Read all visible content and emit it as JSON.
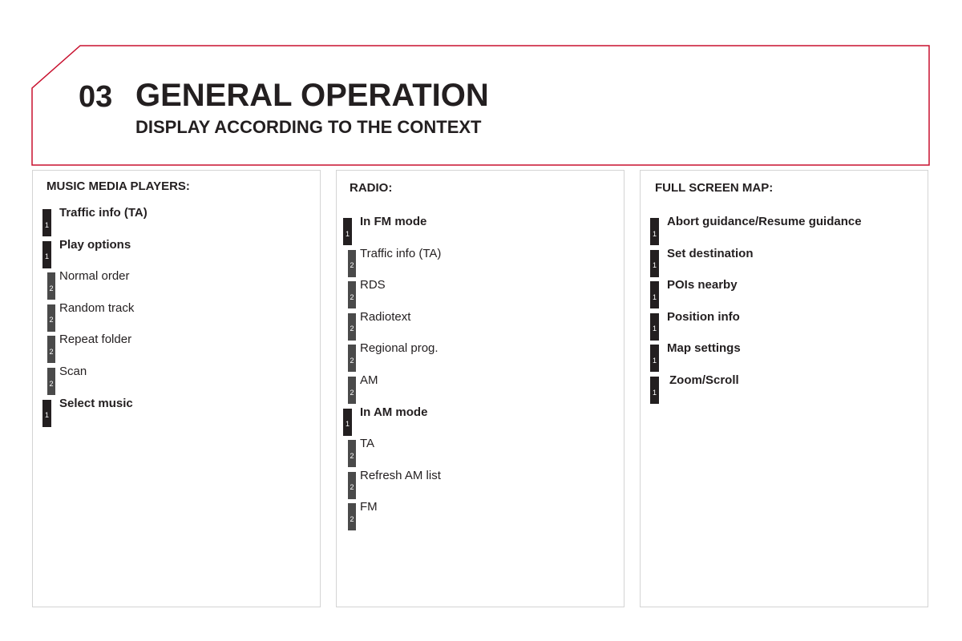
{
  "header": {
    "chapter_number": "03",
    "title": "GENERAL OPERATION",
    "subtitle": "DISPLAY ACCORDING TO THE CONTEXT",
    "frame_color": "#c8102e"
  },
  "panels": [
    {
      "title": "MUSIC MEDIA PLAYERS:",
      "items": [
        {
          "level": "1",
          "label": "Traffic info (TA)"
        },
        {
          "level": "1",
          "label": "Play options"
        },
        {
          "level": "2",
          "label": "Normal order"
        },
        {
          "level": "2",
          "label": "Random track"
        },
        {
          "level": "2",
          "label": "Repeat folder"
        },
        {
          "level": "2",
          "label": "Scan"
        },
        {
          "level": "1",
          "label": "Select music"
        }
      ]
    },
    {
      "title": "RADIO:",
      "items": [
        {
          "level": "1",
          "label": "In FM mode"
        },
        {
          "level": "2",
          "label": "Traffic info (TA)"
        },
        {
          "level": "2",
          "label": "RDS"
        },
        {
          "level": "2",
          "label": "Radiotext"
        },
        {
          "level": "2",
          "label": "Regional prog."
        },
        {
          "level": "2",
          "label": "AM"
        },
        {
          "level": "1",
          "label": "In AM mode"
        },
        {
          "level": "2",
          "label": "TA"
        },
        {
          "level": "2",
          "label": "Refresh AM list"
        },
        {
          "level": "2",
          "label": "FM"
        }
      ]
    },
    {
      "title": "FULL SCREEN MAP:",
      "items": [
        {
          "level": "1",
          "label": "Abort guidance/Resume guidance"
        },
        {
          "level": "1",
          "label": "Set destination"
        },
        {
          "level": "1",
          "label": "POIs nearby"
        },
        {
          "level": "1",
          "label": "Position info"
        },
        {
          "level": "1",
          "label": "Map settings"
        },
        {
          "level": "1",
          "label": "Zoom/Scroll"
        }
      ]
    }
  ]
}
